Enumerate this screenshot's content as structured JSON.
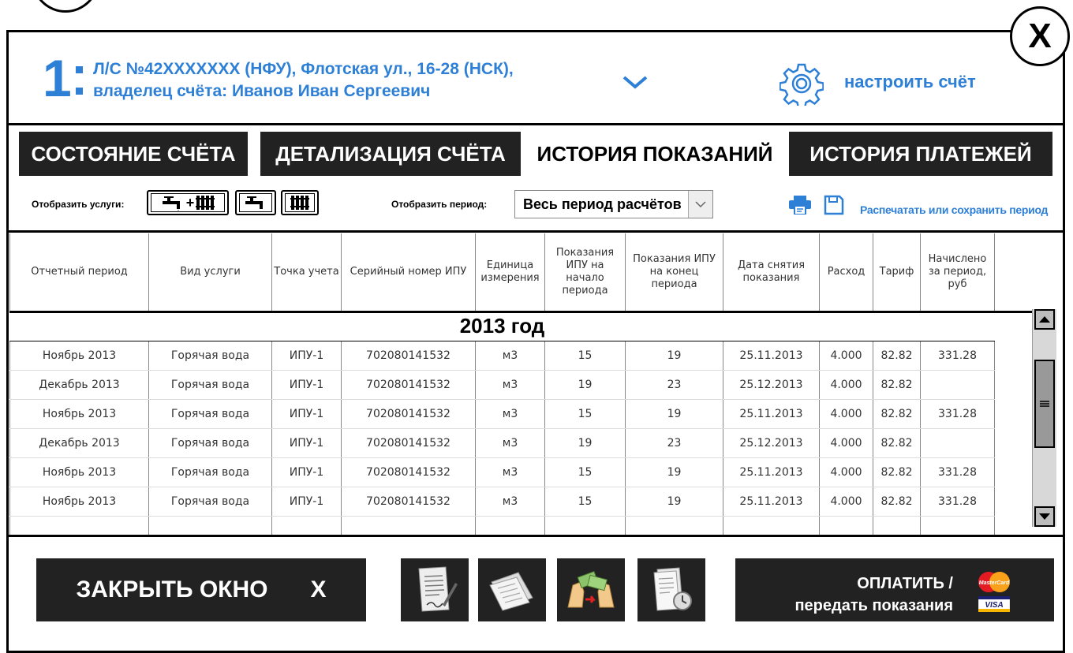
{
  "window": {
    "close_label": "X"
  },
  "account": {
    "number": "1",
    "line1": "Л/С №42XXXXXXX (НФУ), Флотская ул., 16-28 (НСК),",
    "line2": "владелец счёта: Иванов Иван Сергеевич",
    "settings_label": "настроить счёт"
  },
  "tabs": [
    {
      "label": "СОСТОЯНИЕ СЧЁТА",
      "active": false
    },
    {
      "label": "ДЕТАЛИЗАЦИЯ СЧЁТА",
      "active": false
    },
    {
      "label": "ИСТОРИЯ ПОКАЗАНИЙ",
      "active": true
    },
    {
      "label": "ИСТОРИЯ ПЛАТЕЖЕЙ",
      "active": false
    }
  ],
  "filters": {
    "services_label": "Отобразить услуги:",
    "services_plus": "+",
    "period_label": "Отобразить период:",
    "period_value": "Весь период расчётов",
    "print_label": "Распечатать или сохранить период"
  },
  "table": {
    "columns": [
      "Отчетный период",
      "Вид услуги",
      "Точка учета",
      "Серийный номер ИПУ",
      "Единица измерения",
      "Показания ИПУ на начало периода",
      "Показания ИПУ на конец периода",
      "Дата снятия показания",
      "Расход",
      "Тариф",
      "Начислено за период, руб"
    ],
    "year_label": "2013 год",
    "rows": [
      [
        "Ноябрь 2013",
        "Горячая вода",
        "ИПУ-1",
        "702080141532",
        "м3",
        "15",
        "19",
        "25.11.2013",
        "4.000",
        "82.82",
        "331.28"
      ],
      [
        "Декабрь 2013",
        "Горячая вода",
        "ИПУ-1",
        "702080141532",
        "м3",
        "19",
        "23",
        "25.12.2013",
        "4.000",
        "82.82",
        ""
      ],
      [
        "Ноябрь 2013",
        "Горячая вода",
        "ИПУ-1",
        "702080141532",
        "м3",
        "15",
        "19",
        "25.11.2013",
        "4.000",
        "82.82",
        "331.28"
      ],
      [
        "Декабрь 2013",
        "Горячая вода",
        "ИПУ-1",
        "702080141532",
        "м3",
        "19",
        "23",
        "25.12.2013",
        "4.000",
        "82.82",
        ""
      ],
      [
        "Ноябрь 2013",
        "Горячая вода",
        "ИПУ-1",
        "702080141532",
        "м3",
        "15",
        "19",
        "25.11.2013",
        "4.000",
        "82.82",
        "331.28"
      ],
      [
        "Ноябрь 2013",
        "Горячая вода",
        "ИПУ-1",
        "702080141532",
        "м3",
        "15",
        "19",
        "25.11.2013",
        "4.000",
        "82.82",
        "331.28"
      ]
    ]
  },
  "footer": {
    "close_window_label": "ЗАКРЫТЬ ОКНО",
    "close_window_x": "X",
    "pay_line1": "ОПЛАТИТЬ /",
    "pay_line2": "передать показания",
    "card_logos": {
      "mastercard": "MasterCard",
      "visa": "VISA"
    }
  },
  "colors": {
    "accent": "#2e7fd6",
    "dark_button": "#222222"
  },
  "icons": [
    "chevron-down-icon",
    "gear-icon",
    "faucet-icon",
    "radiator-icon",
    "printer-icon",
    "floppy-save-icon",
    "document-sign-icon",
    "papers-icon",
    "money-exchange-icon",
    "document-clock-icon",
    "mastercard-logo",
    "visa-logo"
  ]
}
